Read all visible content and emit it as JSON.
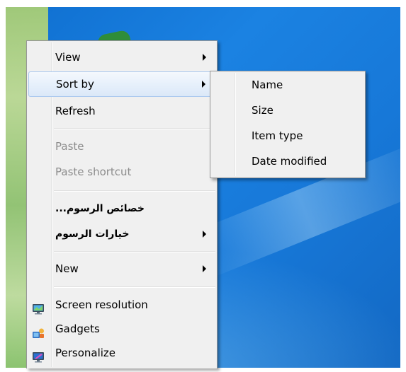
{
  "context_menu": {
    "items": [
      {
        "label": "View"
      },
      {
        "label": "Sort by"
      },
      {
        "label": "Refresh"
      },
      {
        "label": "Paste"
      },
      {
        "label": "Paste shortcut"
      },
      {
        "label": "...خصائص الرسوم"
      },
      {
        "label": "خيارات الرسوم"
      },
      {
        "label": "New"
      },
      {
        "label": "Screen resolution",
        "icon": "monitor-icon"
      },
      {
        "label": "Gadgets",
        "icon": "gadgets-icon"
      },
      {
        "label": "Personalize",
        "icon": "personalize-icon"
      }
    ],
    "disabled": [
      "Paste",
      "Paste shortcut"
    ],
    "highlighted": "Sort by"
  },
  "sort_submenu": {
    "items": [
      {
        "label": "Name"
      },
      {
        "label": "Size"
      },
      {
        "label": "Item type"
      },
      {
        "label": "Date modified"
      }
    ]
  },
  "colors": {
    "desktop_blue": "#1778d8",
    "menu_background": "#f0f0f0",
    "disabled_text": "#8d8d8d",
    "hover_border": "#aac8ee"
  }
}
